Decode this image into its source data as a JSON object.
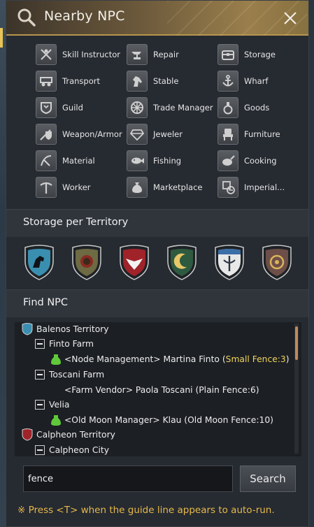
{
  "window": {
    "title": "Nearby NPC"
  },
  "categories": [
    {
      "label": "Skill Instructor",
      "icon": "skill-instructor-icon"
    },
    {
      "label": "Repair",
      "icon": "anvil-icon"
    },
    {
      "label": "Storage",
      "icon": "chest-icon"
    },
    {
      "label": "Transport",
      "icon": "wagon-icon"
    },
    {
      "label": "Stable",
      "icon": "horse-icon"
    },
    {
      "label": "Wharf",
      "icon": "anchor-icon"
    },
    {
      "label": "Guild",
      "icon": "guild-icon"
    },
    {
      "label": "Trade Manager",
      "icon": "wheel-icon"
    },
    {
      "label": "Goods",
      "icon": "potion-icon"
    },
    {
      "label": "Weapon/Armor",
      "icon": "weapon-armor-icon"
    },
    {
      "label": "Jeweler",
      "icon": "gem-icon"
    },
    {
      "label": "Furniture",
      "icon": "chair-icon"
    },
    {
      "label": "Material",
      "icon": "material-icon"
    },
    {
      "label": "Fishing",
      "icon": "fish-icon"
    },
    {
      "label": "Cooking",
      "icon": "cooking-icon"
    },
    {
      "label": "Worker",
      "icon": "pickaxe-icon"
    },
    {
      "label": "Marketplace",
      "icon": "money-bag-icon"
    },
    {
      "label": "Imperial...",
      "icon": "imperial-icon"
    }
  ],
  "storage_section": {
    "title": "Storage per Territory",
    "crests": [
      {
        "icon": "balenos-crest-icon",
        "color": "#3a8fb0"
      },
      {
        "icon": "serendia-crest-icon",
        "color": "#6d6a44"
      },
      {
        "icon": "calpheon-crest-icon",
        "color": "#a0232a"
      },
      {
        "icon": "mediah-crest-icon",
        "color": "#2e5a40"
      },
      {
        "icon": "valencia-crest-icon",
        "color": "#e8e8e8"
      },
      {
        "icon": "kamasylvia-crest-icon",
        "color": "#6e4e48"
      }
    ]
  },
  "find_section": {
    "title": "Find NPC",
    "tree": {
      "territory1": "Balenos Territory",
      "group1": "Finto Farm",
      "npc1_prefix": "<Node Management> Martina Finto (",
      "npc1_highlight": "Small Fence:3",
      "npc1_suffix": ")",
      "group2": "Toscani Farm",
      "npc2": "<Farm Vendor> Paola Toscani (Plain Fence:6)",
      "group3": "Velia",
      "npc3": "<Old Moon Manager> Klau (Old Moon Fence:10)",
      "territory2": "Calpheon Territory",
      "group4": "Calpheon City"
    }
  },
  "search": {
    "value": "fence",
    "button": "Search"
  },
  "hint": "※ Press <T> when the guide line appears to auto-run."
}
